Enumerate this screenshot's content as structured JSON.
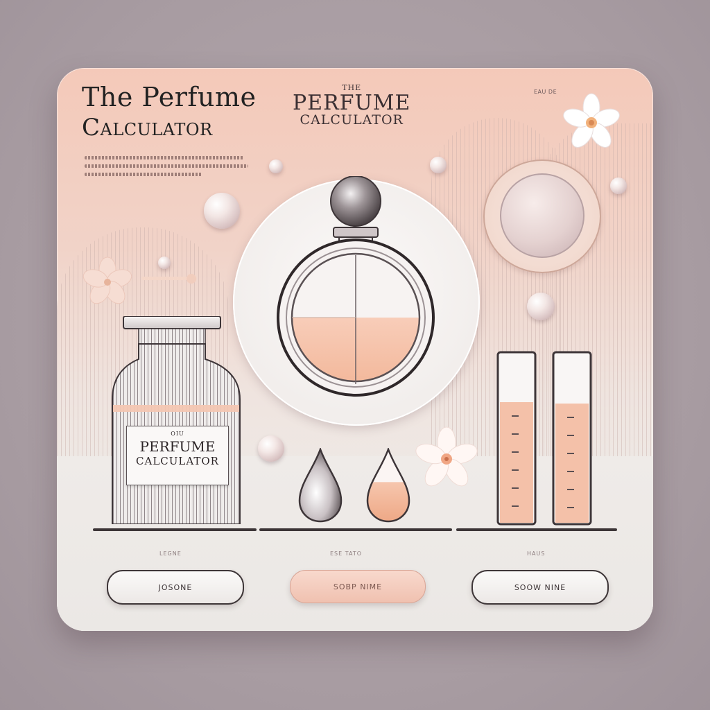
{
  "app": {
    "title_line1": "The Perfume",
    "title_line2": "Calculator"
  },
  "center_heading": {
    "small": "THE",
    "big": "PERFUME",
    "mid": "CALCULATOR"
  },
  "jar_label": {
    "small": "OIU",
    "line1": "PERFUME",
    "line2": "CALCULATOR"
  },
  "corner_label": "EAU DE",
  "buttons": [
    {
      "label": "JOSONE",
      "caption": "LEGNE"
    },
    {
      "label": "SOBP NIME",
      "caption": "ESE TATO"
    },
    {
      "label": "SOOW NINE",
      "caption": "HAUS"
    }
  ],
  "colors": {
    "peach": "#f4c9b9",
    "liquid": "#f5c1a8",
    "outline": "#3e3638"
  },
  "icons": [
    "flower-icon",
    "pearl-icon",
    "drop-icon",
    "test-tube-icon",
    "perfume-bottle-icon",
    "jar-icon"
  ]
}
